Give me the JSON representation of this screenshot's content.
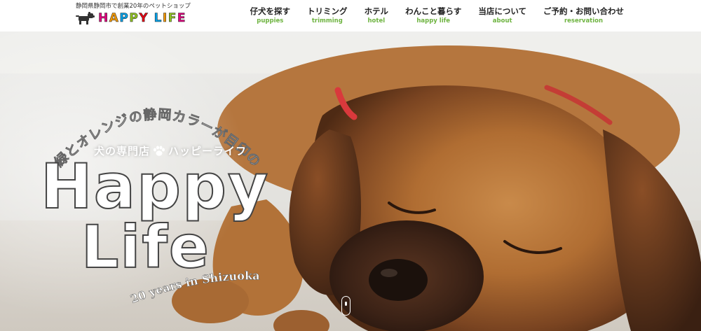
{
  "header": {
    "tagline": "静岡県静岡市で創業20年のペットショップ",
    "logo": {
      "letters": [
        "H",
        "A",
        "P",
        "P",
        "Y",
        " ",
        "L",
        "I",
        "F",
        "E"
      ],
      "colors": [
        "#e4007f",
        "#f39800",
        "#00a0e9",
        "#8fc31f",
        "#e60012",
        " ",
        "#00a0e9",
        "#f39800",
        "#8fc31f",
        "#e4007f"
      ]
    }
  },
  "nav": [
    {
      "jp": "仔犬を探す",
      "en": "puppies"
    },
    {
      "jp": "トリミング",
      "en": "trimming"
    },
    {
      "jp": "ホテル",
      "en": "hotel"
    },
    {
      "jp": "わんこと暮らす",
      "en": "happy life"
    },
    {
      "jp": "当店について",
      "en": "about"
    },
    {
      "jp": "ご予約・お問い合わせ",
      "en": "reservation"
    }
  ],
  "hero": {
    "catchphrase": "緑とオレンジの静岡カラーが目印の",
    "sub_left": "犬の専門店",
    "sub_right": "ハッピーライフ",
    "title_line1": "Happy",
    "title_line2": "Life",
    "years": "20 years in Shizuoka"
  },
  "colors": {
    "nav_en": "#6db33f"
  }
}
